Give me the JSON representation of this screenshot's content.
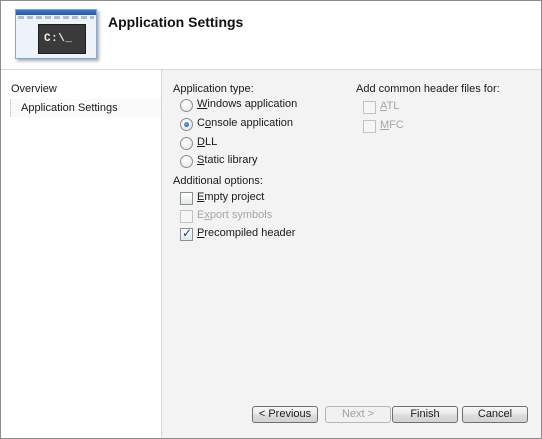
{
  "header": {
    "title": "Application Settings",
    "thumbnail_text": "C:\\_"
  },
  "sidebar": {
    "items": [
      {
        "label": "Overview",
        "selected": false
      },
      {
        "label": "Application Settings",
        "selected": true
      }
    ]
  },
  "application_type": {
    "heading": "Application type:",
    "options": [
      {
        "pre": "",
        "mnemonic": "W",
        "post": "indows application",
        "checked": false
      },
      {
        "pre": "C",
        "mnemonic": "o",
        "post": "nsole application",
        "checked": true
      },
      {
        "pre": "",
        "mnemonic": "D",
        "post": "LL",
        "checked": false
      },
      {
        "pre": "",
        "mnemonic": "S",
        "post": "tatic library",
        "checked": false
      }
    ]
  },
  "additional_options": {
    "heading": "Additional options:",
    "options": [
      {
        "pre": "",
        "mnemonic": "E",
        "post": "mpty project",
        "checked": false,
        "enabled": true
      },
      {
        "pre": "E",
        "mnemonic": "x",
        "post": "port symbols",
        "checked": false,
        "enabled": false
      },
      {
        "pre": "",
        "mnemonic": "P",
        "post": "recompiled header",
        "checked": true,
        "enabled": true
      }
    ]
  },
  "common_headers": {
    "heading": "Add common header files for:",
    "options": [
      {
        "pre": "",
        "mnemonic": "A",
        "post": "TL",
        "checked": false,
        "enabled": false
      },
      {
        "pre": "",
        "mnemonic": "M",
        "post": "FC",
        "checked": false,
        "enabled": false
      }
    ]
  },
  "buttons": {
    "previous": "< Previous",
    "next": "Next >",
    "finish": "Finish",
    "cancel": "Cancel"
  },
  "colors": {
    "pane_background": "#f3f3f3",
    "disabled_text": "#a6a6a6",
    "radio_selected": "#114a9c"
  }
}
